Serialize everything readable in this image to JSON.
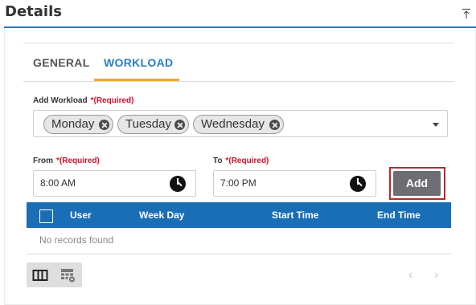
{
  "header": {
    "title": "Details",
    "pin_icon": "collapse-up-icon"
  },
  "tabs": [
    {
      "label": "GENERAL",
      "active": false
    },
    {
      "label": "WORKLOAD",
      "active": true
    }
  ],
  "colors": {
    "accent": "#2a7ec0",
    "tab_underline": "#f0a830",
    "required": "#d0122c",
    "grid_header": "#1a6eb5",
    "add_button": "#6d6e72",
    "focus_outline": "#b52a31"
  },
  "workload": {
    "label": "Add Workload",
    "required": "*(Required)",
    "chips": [
      {
        "label": "Monday"
      },
      {
        "label": "Tuesday"
      },
      {
        "label": "Wednesday"
      }
    ]
  },
  "from": {
    "label": "From",
    "required": "*(Required)",
    "value": "8:00 AM",
    "icon": "clock-icon"
  },
  "to": {
    "label": "To",
    "required": "*(Required)",
    "value": "7:00 PM",
    "icon": "clock-icon"
  },
  "add_button": {
    "label": "Add"
  },
  "grid": {
    "columns": [
      "User",
      "Week Day",
      "Start Time",
      "End Time"
    ],
    "empty_text": "No records found"
  },
  "toolbar": {
    "icons": [
      "columns-icon",
      "grid-settings-icon"
    ]
  },
  "pager": {
    "prev": "‹",
    "next": "›"
  }
}
